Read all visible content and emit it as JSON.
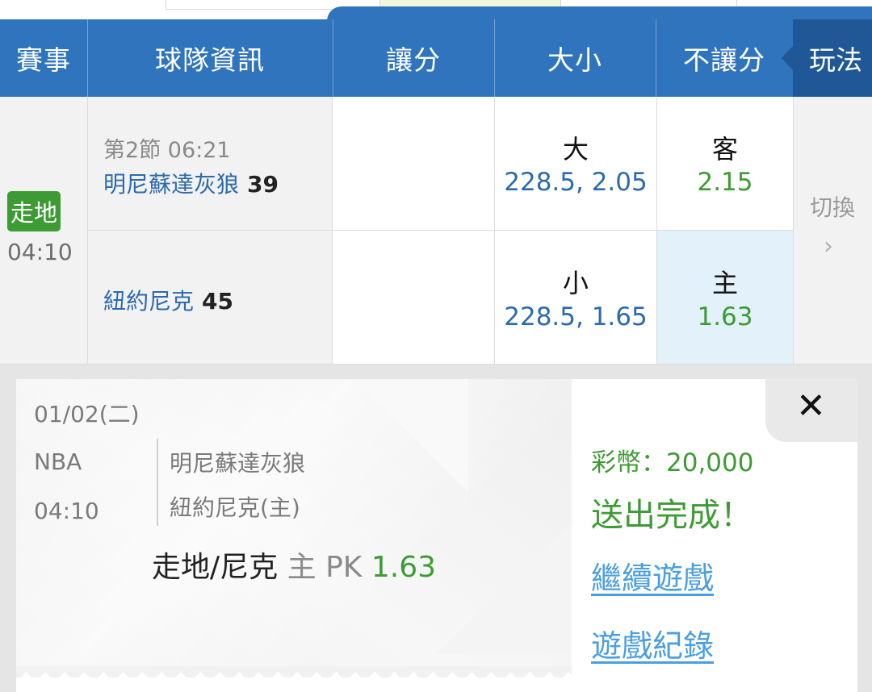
{
  "header": {
    "event": "賽事",
    "team_info": "球隊資訊",
    "handicap": "讓分",
    "over_under": "大小",
    "moneyline": "不讓分",
    "play": "玩法"
  },
  "match": {
    "live_badge": "走地",
    "time": "04:10",
    "period": "第2節 06:21",
    "away_team": "明尼蘇達灰狼",
    "away_score": "39",
    "home_team": "紐約尼克",
    "home_score": "45",
    "over_label": "大",
    "over_value": "228.5, 2.05",
    "under_label": "小",
    "under_value": "228.5, 1.65",
    "away_label": "客",
    "away_odds": "2.15",
    "home_label": "主",
    "home_odds": "1.63",
    "switch_label": "切換",
    "chevron": "›"
  },
  "slip": {
    "date": "01/02(二)",
    "league": "NBA",
    "time": "04:10",
    "away_team": "明尼蘇達灰狼",
    "home_team": "紐約尼克(主)",
    "bet_type": "走地/尼克",
    "bet_side": "主",
    "bet_line": "PK",
    "bet_odds": "1.63",
    "coins": "彩幣：20,000",
    "status": "送出完成！",
    "continue_link": "繼續遊戲",
    "history_link": "遊戲紀錄",
    "close": "✕"
  },
  "colors": {
    "header_blue": "#2f74bd",
    "play_blue": "#1f5797",
    "live_green": "#3d9b34",
    "team_blue": "#2b6aae",
    "link_blue": "#4a9ee2",
    "selected_cell": "#e3f1fb"
  },
  "icons": {
    "close": "close-icon",
    "chevron": "chevron-right-icon"
  }
}
